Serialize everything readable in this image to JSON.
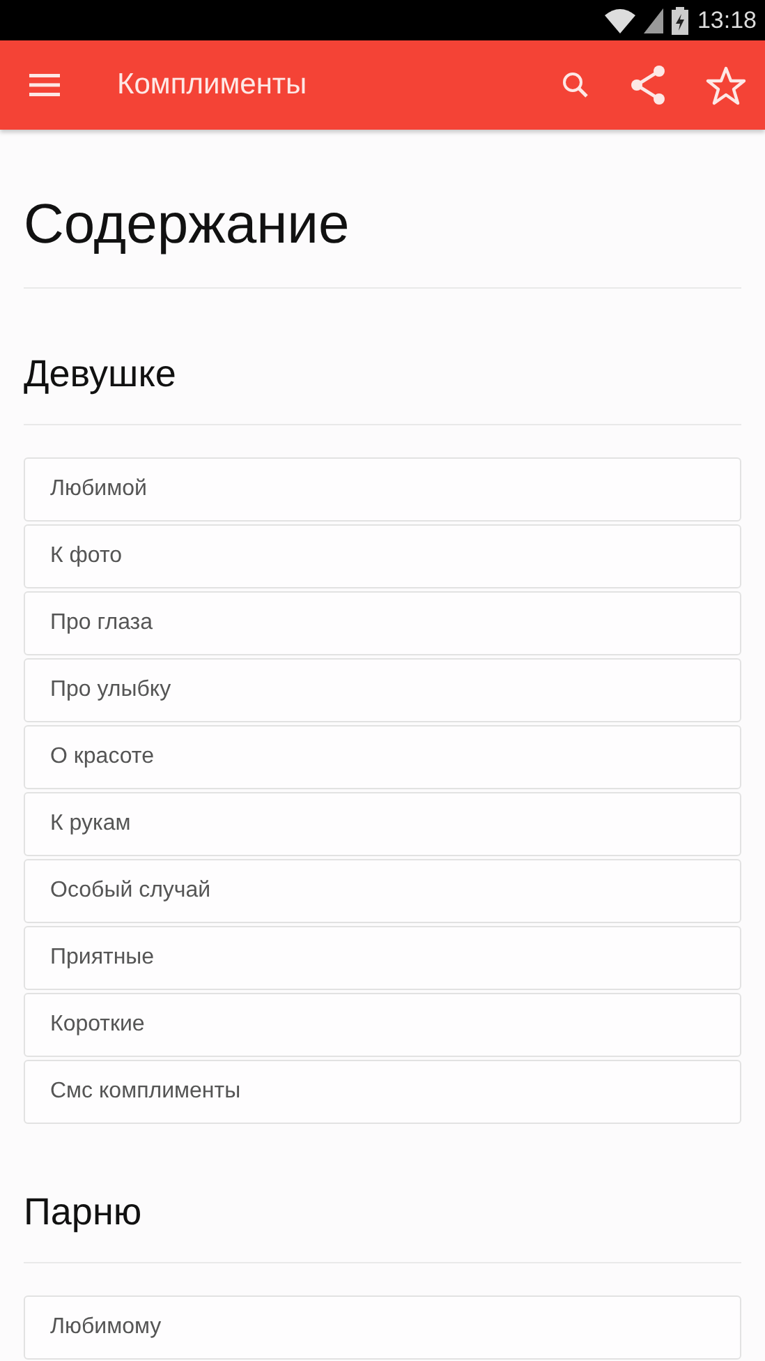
{
  "status_bar": {
    "time": "13:18"
  },
  "app_bar": {
    "title": "Комплименты"
  },
  "page": {
    "title": "Содержание",
    "sections": [
      {
        "title": "Девушке",
        "items": [
          "Любимой",
          "К фото",
          "Про глаза",
          "Про улыбку",
          "О красоте",
          "К рукам",
          "Особый случай",
          "Приятные",
          "Короткие",
          "Смс комплименты"
        ]
      },
      {
        "title": "Парню",
        "items": [
          "Любимому"
        ]
      }
    ]
  }
}
